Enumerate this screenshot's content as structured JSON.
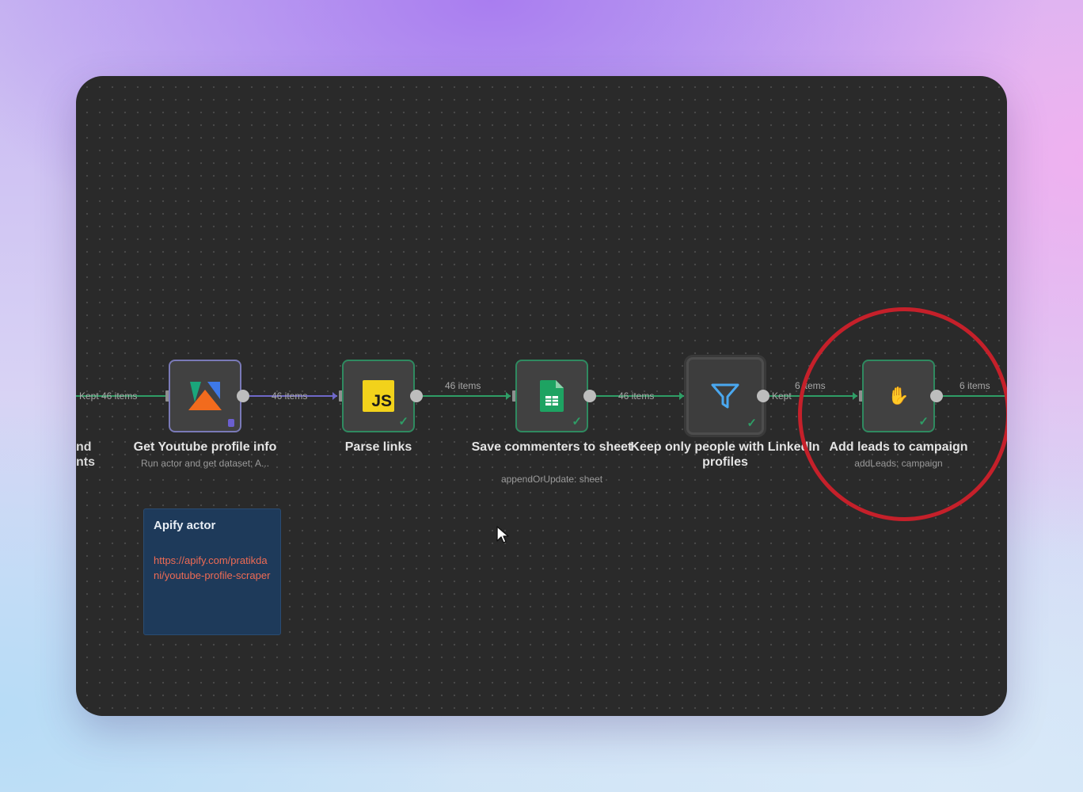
{
  "canvas": {
    "partial_node": {
      "line1": "nd",
      "line2": "nts"
    },
    "edges": {
      "kept": "Kept",
      "e0": "46 items",
      "e1": "46 items",
      "e2": "46 items",
      "e3": "46 items",
      "e4_kept": "Kept",
      "e4": "6 items",
      "e5": "6 items"
    },
    "nodes": [
      {
        "title": "Get Youtube profile info",
        "subtitle": "Run actor and get dataset: A...",
        "icon": "apify-icon"
      },
      {
        "title": "Parse links",
        "subtitle": "",
        "icon": "javascript-icon",
        "icon_text": "JS"
      },
      {
        "title": "Save commenters to sheet",
        "subtitle": "appendOrUpdate: sheet",
        "icon": "google-sheets-icon"
      },
      {
        "title": "Keep only people with LinkedIn profiles",
        "subtitle": "",
        "icon": "filter-icon"
      },
      {
        "title": "Add leads to campaign",
        "subtitle": "addLeads: campaign",
        "icon": "wave-hand-icon"
      }
    ],
    "sticky_note": {
      "title": "Apify actor",
      "link": "https://apify.com/pratikdani/youtube-profile-scraper"
    }
  },
  "colors": {
    "canvas_bg": "#2a2a2a",
    "success_border": "#2f8a60",
    "highlight": "#c5202a",
    "note_bg": "#1e3a5a",
    "note_link": "#ef6b54"
  }
}
